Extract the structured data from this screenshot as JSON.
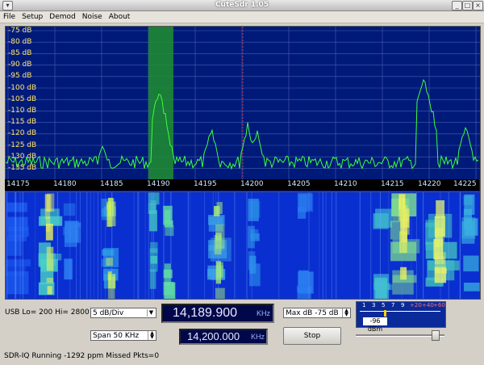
{
  "window": {
    "title": "CuteSdr 1.05"
  },
  "menu": {
    "items": [
      "File",
      "Setup",
      "Demod",
      "Noise",
      "About"
    ]
  },
  "spectrum": {
    "db_labels": [
      "-75 dB",
      "-80 dB",
      "-85 dB",
      "-90 dB",
      "-95 dB",
      "-100 dB",
      "-105 dB",
      "-110 dB",
      "-115 dB",
      "-120 dB",
      "-125 dB",
      "-130 dB",
      "-135 dB"
    ],
    "freq_labels": [
      "14175",
      "14180",
      "14185",
      "14190",
      "14195",
      "14200",
      "14205",
      "14210",
      "14215",
      "14220",
      "14225"
    ],
    "colors": {
      "background": "#001a7a",
      "grid": "#4a5fb0",
      "trace": "#3cff3c",
      "passband": "#1e8f2e",
      "db_text": "#ffe36b"
    }
  },
  "controls": {
    "demod_label": "USB Lo= 200  Hi= 2800",
    "div_select": "5 dB/Div",
    "span_select": "Span 50 KHz",
    "maxdb_select": "Max dB -75 dB",
    "freq_main": "14,189.900",
    "freq_main_unit": "KHz",
    "freq_center": "14,200.000",
    "freq_center_unit": "KHz",
    "stop_button": "Stop",
    "smeter_scale": [
      "1",
      "3",
      "5",
      "7",
      "9",
      "+20",
      "+40",
      "+60"
    ],
    "smeter_value": "-96 dBm"
  },
  "status": {
    "text": "SDR-IQ Running   -1292 ppm   Missed Pkts=0"
  }
}
